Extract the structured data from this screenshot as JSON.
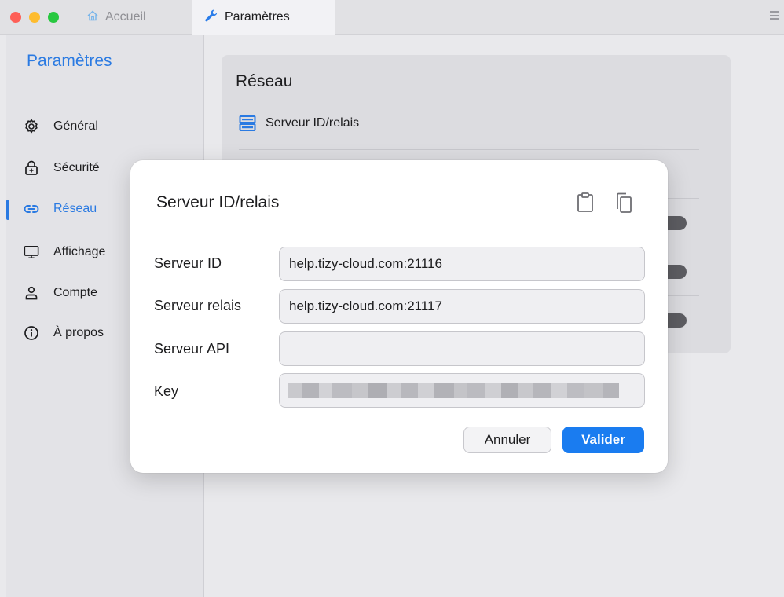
{
  "tabs": {
    "home_label": "Accueil",
    "settings_label": "Paramètres"
  },
  "sidebar": {
    "title": "Paramètres",
    "items": [
      {
        "label": "Général",
        "icon": "gear-icon"
      },
      {
        "label": "Sécurité",
        "icon": "lock-icon"
      },
      {
        "label": "Réseau",
        "icon": "link-icon",
        "active": true
      },
      {
        "label": "Affichage",
        "icon": "monitor-icon"
      },
      {
        "label": "Compte",
        "icon": "user-icon"
      },
      {
        "label": "À propos",
        "icon": "info-icon"
      }
    ]
  },
  "card": {
    "title": "Réseau",
    "row_label": "Serveur ID/relais"
  },
  "modal": {
    "title": "Serveur ID/relais",
    "fields": {
      "id_label": "Serveur ID",
      "id_value": "help.tizy-cloud.com:21116",
      "relay_label": "Serveur relais",
      "relay_value": "help.tizy-cloud.com:21117",
      "api_label": "Serveur API",
      "api_value": "",
      "key_label": "Key"
    },
    "cancel_label": "Annuler",
    "ok_label": "Valider"
  },
  "colors": {
    "accent": "#2a7ae2",
    "primary_button": "#1a7cf0"
  }
}
